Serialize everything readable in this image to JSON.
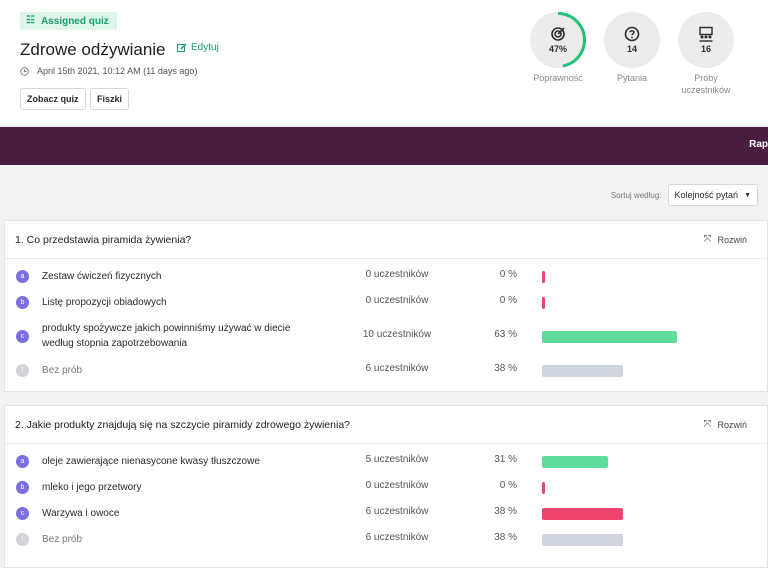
{
  "header": {
    "badge": "Assigned quiz",
    "title": "Zdrowe odżywianie",
    "edit_label": "Edytuj",
    "date": "April 15th 2021, 10:12 AM (11 days ago)",
    "buttons": [
      "Zobacz quiz",
      "Fiszki"
    ]
  },
  "stats": [
    {
      "icon": "target-icon",
      "value": "47%",
      "label": "Poprawność",
      "progress": 0.47
    },
    {
      "icon": "question-icon",
      "value": "14",
      "label": "Pytania"
    },
    {
      "icon": "participants-icon",
      "value": "16",
      "label": "Próby uczestników"
    }
  ],
  "banner": {
    "text": "Rap"
  },
  "sort": {
    "label": "Sortuj według:",
    "value": "Kolejność pytań"
  },
  "colors": {
    "accent": "#16a26a",
    "correct": "#5ddc9c",
    "wrong": "#ef4470",
    "none": "#d0d4dc",
    "banner": "#4a1c3d",
    "letter": "#7b6ee0"
  },
  "questions": [
    {
      "title": "1. Co przedstawia piramida żywienia?",
      "expand_label": "Rozwiń",
      "answers": [
        {
          "letter": "a",
          "text": "Zestaw ćwiczeń fizycznych",
          "count": "0 uczestników",
          "percent": "0 %",
          "value": 0,
          "status": "wrong"
        },
        {
          "letter": "b",
          "text": "Listę propozycji obiadowych",
          "count": "0 uczestników",
          "percent": "0 %",
          "value": 0,
          "status": "wrong"
        },
        {
          "letter": "c",
          "text": "produkty spożywcze jakich powinniśmy używać w diecie według stopnia zapotrzebowania",
          "count": "10 uczestników",
          "percent": "63 %",
          "value": 63,
          "status": "correct"
        },
        {
          "letter": "!",
          "text": "Bez prób",
          "count": "6 uczestników",
          "percent": "38 %",
          "value": 38,
          "status": "none"
        }
      ]
    },
    {
      "title": "2. Jakie produkty znajdują się na szczycie piramidy zdrowego żywienia?",
      "expand_label": "Rozwiń",
      "answers": [
        {
          "letter": "a",
          "text": "oleje zawierające nienasycone kwasy tłuszczowe",
          "count": "5 uczestników",
          "percent": "31 %",
          "value": 31,
          "status": "correct"
        },
        {
          "letter": "b",
          "text": "mleko i jego przetwory",
          "count": "0 uczestników",
          "percent": "0 %",
          "value": 0,
          "status": "wrong"
        },
        {
          "letter": "c",
          "text": "Warzywa i owoce",
          "count": "6 uczestników",
          "percent": "38 %",
          "value": 38,
          "status": "wrong"
        },
        {
          "letter": "!",
          "text": "Bez prób",
          "count": "6 uczestników",
          "percent": "38 %",
          "value": 38,
          "status": "none"
        }
      ]
    }
  ]
}
